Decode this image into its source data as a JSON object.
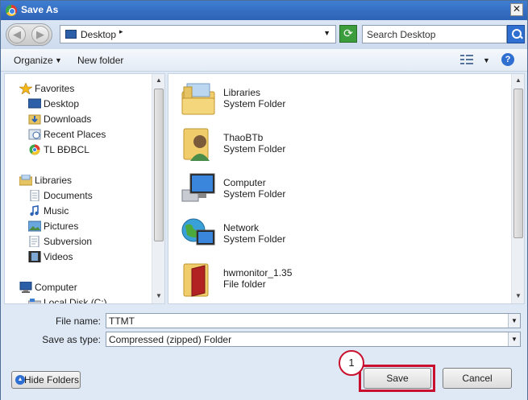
{
  "window": {
    "title": "Save As",
    "close_glyph": "✕"
  },
  "address": {
    "location": "Desktop",
    "chevron": "▸",
    "dropdown": "▼",
    "back_glyph": "◀",
    "forward_glyph": "▶",
    "refresh_glyph": "⟳"
  },
  "search": {
    "placeholder": "Search Desktop"
  },
  "toolbar": {
    "organize_label": "Organize",
    "organize_chevron": "▼",
    "new_folder_label": "New folder",
    "view_chevron": "▼",
    "help_glyph": "?"
  },
  "navpane": {
    "favorites": {
      "label": "Favorites",
      "items": [
        {
          "label": "Desktop",
          "icon": "desktop-icon"
        },
        {
          "label": "Downloads",
          "icon": "downloads-icon"
        },
        {
          "label": "Recent Places",
          "icon": "recent-places-icon"
        },
        {
          "label": "TL BĐBCL",
          "icon": "chrome-icon"
        }
      ]
    },
    "libraries": {
      "label": "Libraries",
      "items": [
        {
          "label": "Documents",
          "icon": "documents-icon"
        },
        {
          "label": "Music",
          "icon": "music-icon"
        },
        {
          "label": "Pictures",
          "icon": "pictures-icon"
        },
        {
          "label": "Subversion",
          "icon": "subversion-icon"
        },
        {
          "label": "Videos",
          "icon": "videos-icon"
        }
      ]
    },
    "computer": {
      "label": "Computer",
      "items": [
        {
          "label": "Local Disk (C:)",
          "icon": "local-disk-icon"
        }
      ]
    },
    "scroll_up": "▲",
    "scroll_down": "▼"
  },
  "files": [
    {
      "name": "Libraries",
      "type": "System Folder",
      "icon": "libraries-folder-icon"
    },
    {
      "name": "ThaoBTb",
      "type": "System Folder",
      "icon": "user-folder-icon"
    },
    {
      "name": "Computer",
      "type": "System Folder",
      "icon": "computer-icon"
    },
    {
      "name": "Network",
      "type": "System Folder",
      "icon": "network-icon"
    },
    {
      "name": "hwmonitor_1.35",
      "type": "File folder",
      "icon": "folder-icon"
    }
  ],
  "form": {
    "file_name_label": "File name:",
    "file_name_value": "TTMT",
    "save_type_label": "Save as type:",
    "save_type_value": "Compressed (zipped) Folder",
    "dropdown_glyph": "▼"
  },
  "buttons": {
    "hide_folders": "Hide Folders",
    "hide_chevron": "▲",
    "save": "Save",
    "cancel": "Cancel"
  },
  "annotation": {
    "callout_number": "1",
    "highlight_color": "#c8102e"
  },
  "colors": {
    "titlebar": "#2d62b5",
    "frame": "#dfe9f5",
    "accent": "#2f6fd1"
  }
}
